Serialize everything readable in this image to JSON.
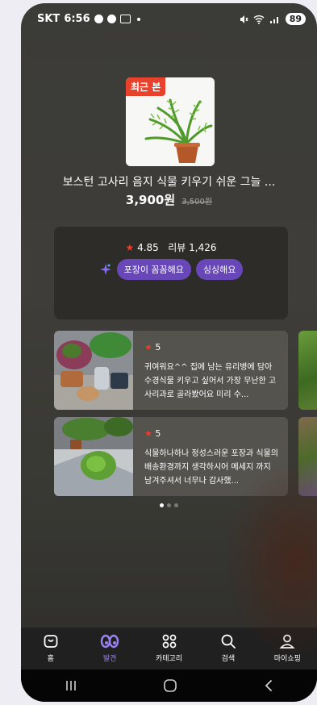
{
  "status_bar": {
    "carrier": "SKT",
    "time": "6:56",
    "battery": "89"
  },
  "recent": {
    "badge": "최근 본",
    "title": "보스턴 고사리 음지 식물 키우기 쉬운 그늘 ...",
    "price": "3,900원",
    "original_price": "3,500원"
  },
  "info": {
    "rating": "4.85",
    "reviews": "리뷰 1,426",
    "chips": [
      "포장이 꼼꼼해요",
      "싱싱해요"
    ]
  },
  "reviews": [
    {
      "rating": "5",
      "text": "귀여워요^^  집에 남는 유리병에 담아 수경식물 키우고 싶어서 가장 무난한 고사리과로 골라봤어요 미리 수..."
    },
    {
      "rating": "5",
      "text": "식물하나하나 정성스러운 포장과 식물의 배송환경까지 생각하시어 메세지 까지 남겨주셔서 너무나 감사했..."
    }
  ],
  "tabs": [
    {
      "label": "홈",
      "icon": "shopping-bag-icon"
    },
    {
      "label": "발견",
      "icon": "eyes-icon"
    },
    {
      "label": "카테고리",
      "icon": "grid-icon"
    },
    {
      "label": "검색",
      "icon": "search-icon"
    },
    {
      "label": "마이쇼핑",
      "icon": "person-icon"
    }
  ],
  "colors": {
    "accent": "#9b82f2",
    "chip": "#6847b8",
    "badge": "#e8412c",
    "star": "#f03b2b"
  }
}
